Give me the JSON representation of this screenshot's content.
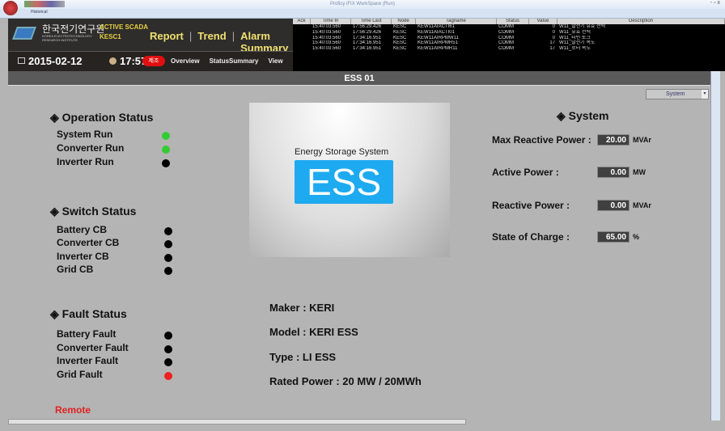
{
  "window": {
    "title": "Proficy iFIX WorkSpace (Run)",
    "ribbon_tab": "Historical"
  },
  "header": {
    "org_kr": "한국전기연구원",
    "org_en1": "KOREA ELECTROTECHNOLOGY",
    "org_en2": "RESEARCH INSTITUTE",
    "app": "ACTIVE SCADA",
    "node": "KESC1",
    "links": [
      "Report",
      "|",
      "Trend",
      "|",
      "Alarm Summary"
    ],
    "date": "2015-02-12",
    "time": "17:57:40",
    "mode_badge": "제조",
    "nav": [
      "Overview",
      "StatusSummary",
      "View"
    ]
  },
  "alarm": {
    "columns": [
      "Ack",
      "Time In",
      "Time Last",
      "Node",
      "Tagname",
      "Status",
      "Value",
      "Description"
    ],
    "rows": [
      [
        "",
        "15:40:03.560",
        "17:56:29.426",
        "KESC",
        "KEW11AIACTI61",
        "COMM",
        "0",
        "W11_발전기 유효 전력"
      ],
      [
        "",
        "15:40:03.560",
        "17:56:29.426",
        "KESC",
        "KEW11AIACTI01",
        "COMM",
        "0",
        "W11_유효 전력"
      ],
      [
        "",
        "15:40:03.560",
        "17:34:16.951",
        "KESC",
        "KEW11AIRPMW11",
        "COMM",
        "0",
        "W11_터빈 토크"
      ],
      [
        "",
        "15:40:03.560",
        "17:34:16.951",
        "KESC",
        "KEW11AIRPMR51",
        "COMM",
        "17",
        "W11_발전기 속도"
      ],
      [
        "",
        "15:40:03.560",
        "17:34:16.951",
        "KESC",
        "KEW11AIRPMR11",
        "COMM",
        "17",
        "W11_로터 속도"
      ]
    ]
  },
  "screen_title": "ESS 01",
  "dropdown": {
    "value": "System"
  },
  "operation": {
    "title": "Operation Status",
    "items": [
      {
        "label": "System Run",
        "color": "#33cc33"
      },
      {
        "label": "Converter Run",
        "color": "#33cc33"
      },
      {
        "label": "Inverter Run",
        "color": "#000000"
      }
    ]
  },
  "switch": {
    "title": "Switch Status",
    "items": [
      {
        "label": "Battery CB",
        "color": "#000000"
      },
      {
        "label": "Converter CB",
        "color": "#000000"
      },
      {
        "label": "Inverter CB",
        "color": "#000000"
      },
      {
        "label": "Grid CB",
        "color": "#000000"
      }
    ]
  },
  "fault": {
    "title": "Fault Status",
    "items": [
      {
        "label": "Battery Fault",
        "color": "#000000"
      },
      {
        "label": "Converter Fault",
        "color": "#000000"
      },
      {
        "label": "Inverter Fault",
        "color": "#000000"
      },
      {
        "label": "Grid Fault",
        "color": "#ee2222"
      }
    ]
  },
  "remote": "Remote",
  "image": {
    "caption": "Energy Storage System",
    "logo": "ESS"
  },
  "info": {
    "maker": "Maker :  KERI",
    "model": "Model :  KERI ESS",
    "type": "Type :   LI ESS",
    "rated": "Rated Power :  20 MW / 20MWh"
  },
  "system": {
    "title": "System",
    "rows": [
      {
        "label": "Max Reactive Power :",
        "value": "20.00",
        "unit": "MVAr"
      },
      {
        "label": "Active Power :",
        "value": "0.00",
        "unit": "MW"
      },
      {
        "label": "Reactive Power :",
        "value": "0.00",
        "unit": "MVAr"
      },
      {
        "label": "State of Charge :",
        "value": "65.00",
        "unit": "%"
      }
    ]
  }
}
